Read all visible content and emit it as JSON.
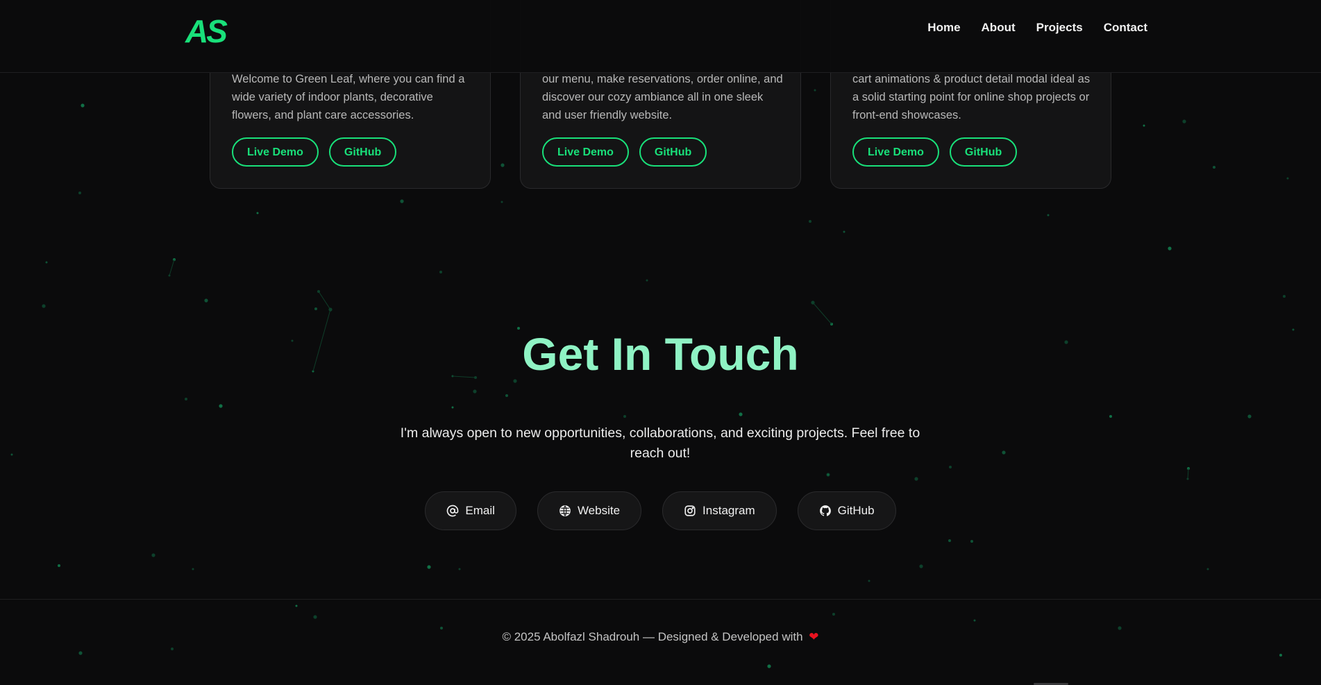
{
  "header": {
    "logo": "AS",
    "nav": [
      "Home",
      "About",
      "Projects",
      "Contact"
    ]
  },
  "projects": [
    {
      "description": "Welcome to Green Leaf, where you can find a wide variety of indoor plants, decorative flowers, and plant care accessories.",
      "live_demo": "Live Demo",
      "github": "GitHub"
    },
    {
      "description": "our menu, make reservations, order online, and discover our cozy ambiance all in one sleek and user friendly website.",
      "live_demo": "Live Demo",
      "github": "GitHub"
    },
    {
      "description": "cart animations & product detail modal ideal as a solid starting point for online shop projects or front-end showcases.",
      "live_demo": "Live Demo",
      "github": "GitHub"
    }
  ],
  "contact": {
    "title": "Get In Touch",
    "subtitle": "I'm always open to new opportunities, collaborations, and exciting projects. Feel free to reach out!",
    "links": [
      {
        "label": "Email",
        "icon": "at-icon"
      },
      {
        "label": "Website",
        "icon": "globe-icon"
      },
      {
        "label": "Instagram",
        "icon": "instagram-icon"
      },
      {
        "label": "GitHub",
        "icon": "github-icon"
      }
    ]
  },
  "footer": {
    "text": "© 2025 Abolfazl Shadrouh — Designed & Developed with",
    "heart": "❤"
  },
  "colors": {
    "accent": "#19e07a",
    "title": "#8ff3c4",
    "background": "#0b0b0c",
    "card": "#141415",
    "heart": "#e8121f"
  }
}
